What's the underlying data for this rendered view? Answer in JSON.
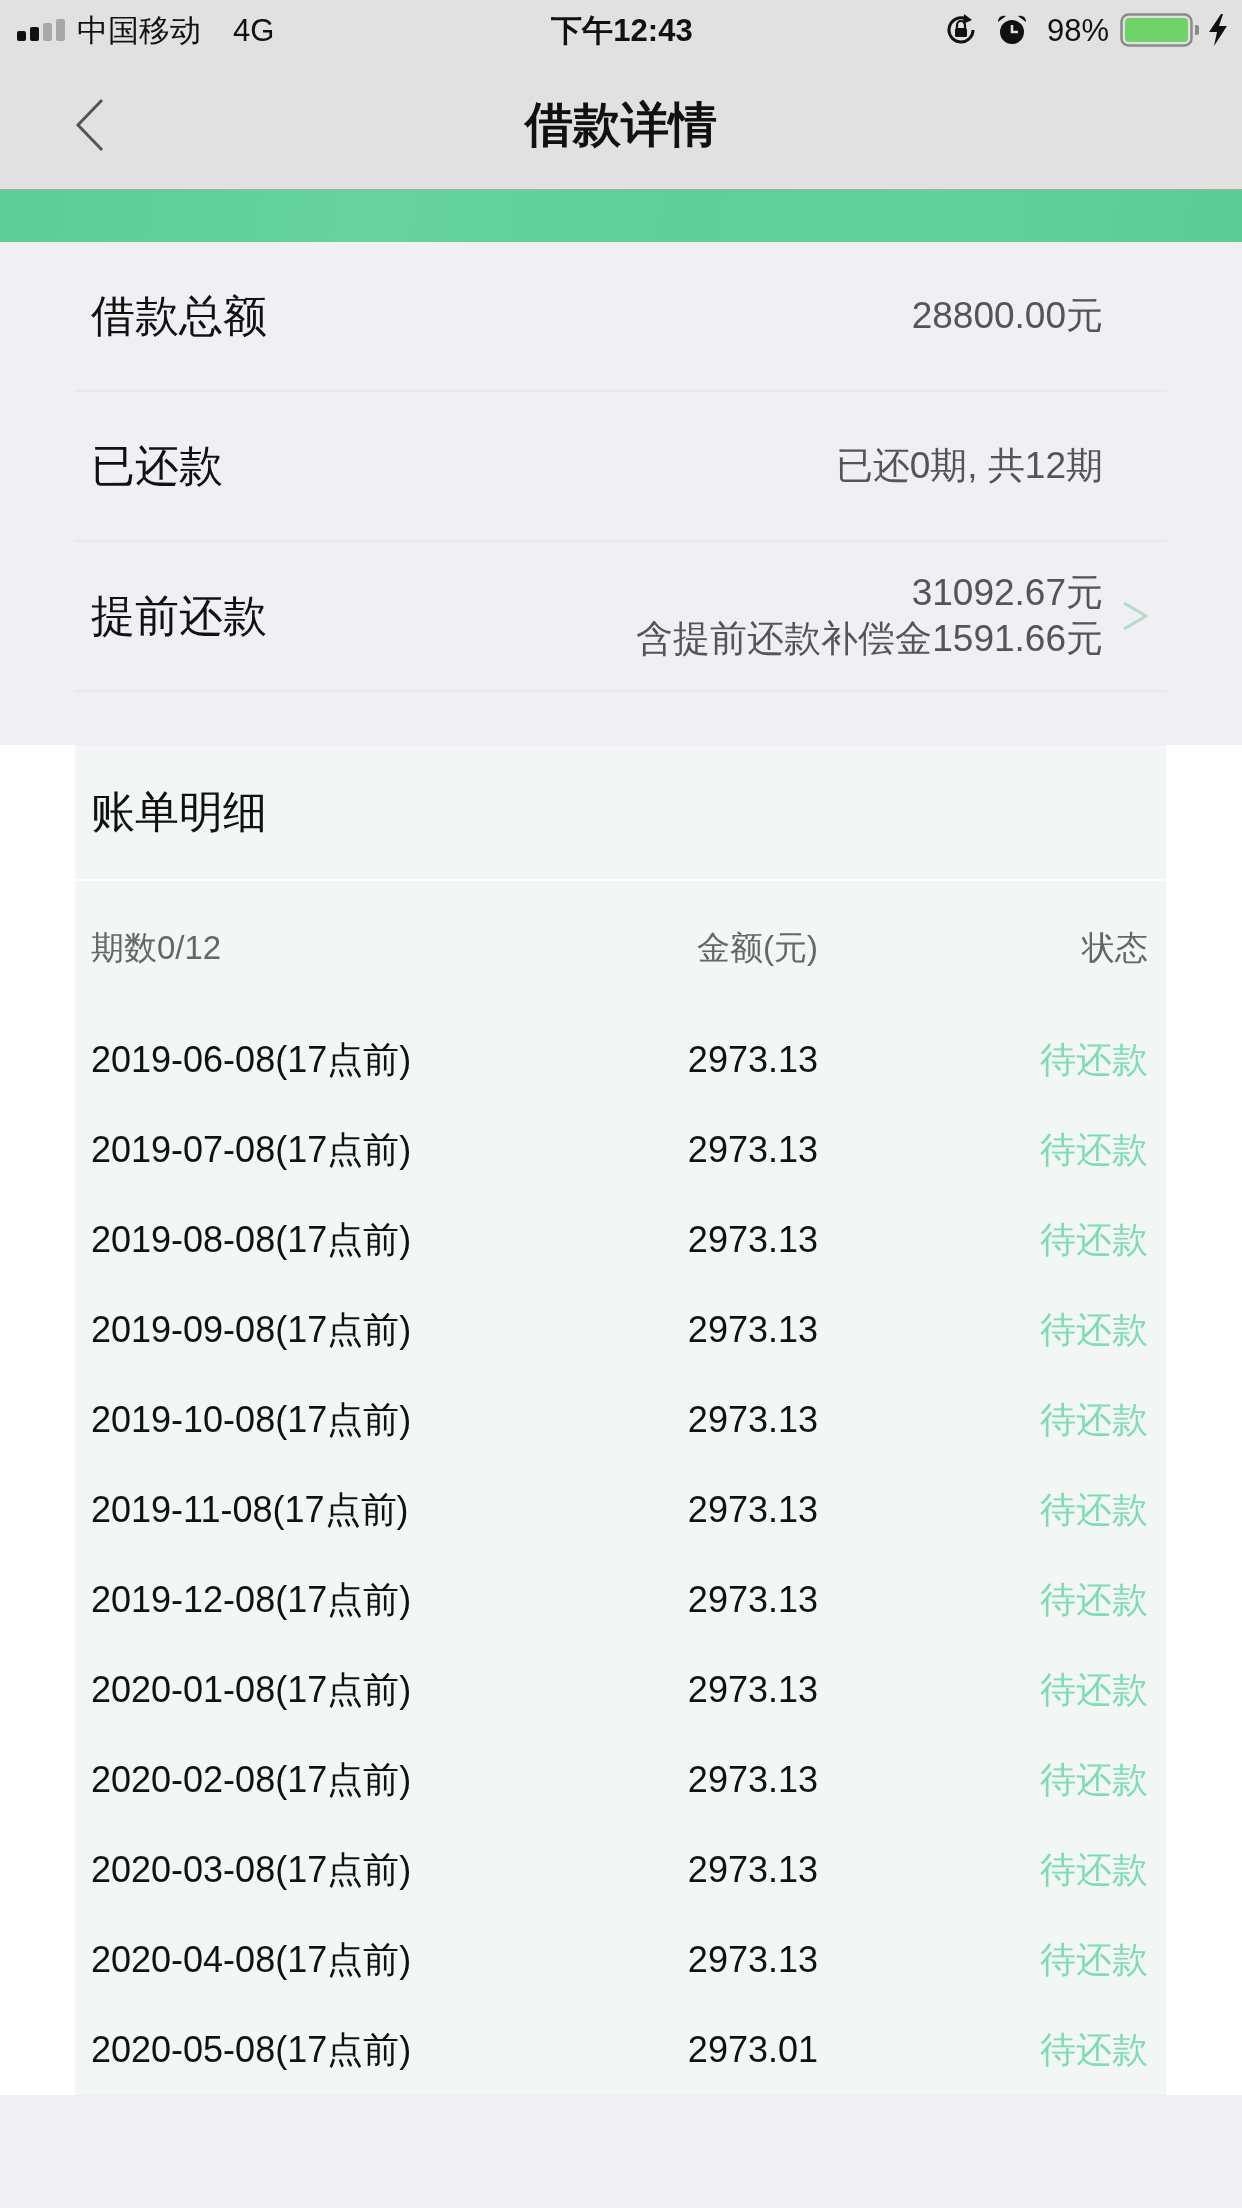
{
  "status_bar": {
    "carrier": "中国移动",
    "network": "4G",
    "time": "下午12:43",
    "battery": "98%"
  },
  "nav_bar": {
    "title": "借款详情"
  },
  "summary": [
    {
      "kind": "plain",
      "label": "借款总额",
      "value": "28800.00元"
    },
    {
      "kind": "plain",
      "label": "已还款",
      "value": "已还0期, 共12期"
    },
    {
      "kind": "link",
      "label": "提前还款",
      "value": "31092.67元",
      "note": "含提前还款补偿金1591.66元"
    }
  ],
  "bill": {
    "title": "账单明细",
    "columns": [
      "期数0/12",
      "金额(元)",
      "状态"
    ],
    "rows": [
      {
        "date": "2019-06-08(17点前)",
        "amount": "2973.13",
        "status": "待还款"
      },
      {
        "date": "2019-07-08(17点前)",
        "amount": "2973.13",
        "status": "待还款"
      },
      {
        "date": "2019-08-08(17点前)",
        "amount": "2973.13",
        "status": "待还款"
      },
      {
        "date": "2019-09-08(17点前)",
        "amount": "2973.13",
        "status": "待还款"
      },
      {
        "date": "2019-10-08(17点前)",
        "amount": "2973.13",
        "status": "待还款"
      },
      {
        "date": "2019-11-08(17点前)",
        "amount": "2973.13",
        "status": "待还款"
      },
      {
        "date": "2019-12-08(17点前)",
        "amount": "2973.13",
        "status": "待还款"
      },
      {
        "date": "2020-01-08(17点前)",
        "amount": "2973.13",
        "status": "待还款"
      },
      {
        "date": "2020-02-08(17点前)",
        "amount": "2973.13",
        "status": "待还款"
      },
      {
        "date": "2020-03-08(17点前)",
        "amount": "2973.13",
        "status": "待还款"
      },
      {
        "date": "2020-04-08(17点前)",
        "amount": "2973.13",
        "status": "待还款"
      },
      {
        "date": "2020-05-08(17点前)",
        "amount": "2973.01",
        "status": "待还款"
      }
    ]
  }
}
